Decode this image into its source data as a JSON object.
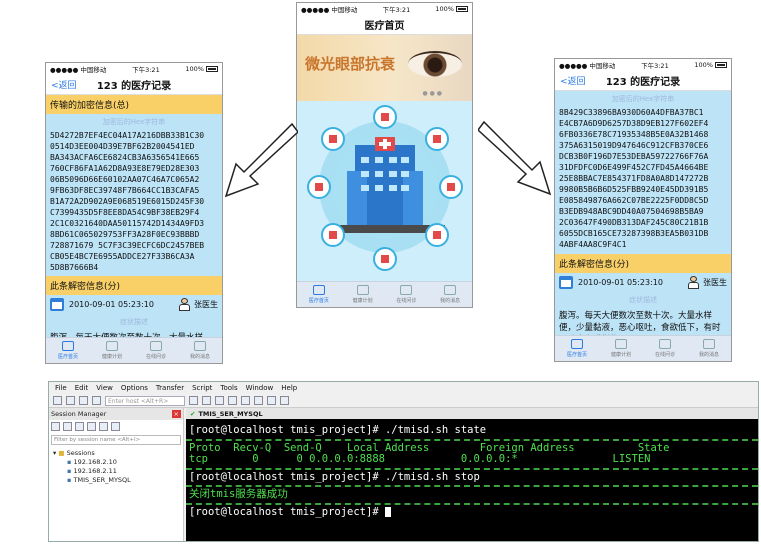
{
  "status_bar": {
    "carrier": "●●●●● 中国移动",
    "time": "下午3:21",
    "battery": "100%"
  },
  "left_phone": {
    "nav": {
      "back": "<返回",
      "title": "123 的医疗记录"
    },
    "enc_header": "传输的加密信息(总)",
    "faint_label": "加密后的Hex字符串",
    "hex_lines": [
      "5D4272B7EF4EC04A17A216DBB33B1C30",
      "0514D3EE004D39E7BF62B2004541ED",
      "BA343ACFA6CE6824CB3A6356541E665",
      "760CF86FA1A62D8A93E8E79ED28E303",
      "06B5096D66E60102AA07C46A7C065A2",
      "9FB63DF8EC39748F7B664CC1B3CAFA5",
      "B1A72A2D902A9E068519E6015D245F30",
      "C7399435D5F8EE8DA54C9BF38EB29F4",
      "2C1C0321640DAA50115742D1434A9FD3",
      "8BD61C065029753FF3A28F0EC93BBBD",
      "728871679 5C7F3C39ECFC6DC2457BEB",
      "CB05E4BC7E6955ADDCE27F33B6CA3A",
      "5D8B7666B4"
    ],
    "dec_header": "此条解密信息(分)",
    "date": "2010-09-01 05:23:10",
    "doctor": "张医生",
    "faint_label2": "症状描述",
    "desc": "腹泻。每天大便数次至数十次。大量水样便，少量黏液，恶心呕吐，食欲低下，有"
  },
  "center_phone": {
    "nav_title": "医疗首页",
    "banner_text": "微光眼部抗衰",
    "tabs": [
      "医疗首页",
      "健康计划",
      "在线问诊",
      "我的消息"
    ]
  },
  "right_phone": {
    "nav": {
      "back": "<返回",
      "title": "123 的医疗记录"
    },
    "faint_label": "加密后的Hex字符串",
    "hex_lines": [
      "8B429C33896BA930D60A4DFBA37BC1",
      "E4CB7A6D9D6257D38D9EB127F602EF4",
      "6FB0336E78C71935348B5E0A32B1468",
      "375A6315019D947646C912CFB370CE6",
      "DCB3B0F196D7E53DEBA59722766F76A",
      "31DFDFC0D6E499F452C7FD45A4664BE",
      "25E8BBAC7E854371FD8A0A8D147272B",
      "9980B5B6B6D525FBB9240E45DD391B5",
      "E085849876A662C07BE2225F0DD8C5D",
      "B3EDB948ABC9DD40A07504698B5BA9",
      "2C03647F490DB313DAF245C80C21B1B",
      "6055DCB165CE73287398B3EA5B031DB",
      "4ABF4AA8C9F4C1"
    ],
    "dec_header": "此条解密信息(分)",
    "date": "2010-09-01 05:23:10",
    "doctor": "张医生",
    "faint_label2": "症状描述",
    "desc": "腹泻。每天大便数次至数十次。大量水样便，少量黏液，恶心呕吐，食欲低下，有时呕吐出咖啡样物"
  },
  "phone_tabs": [
    "医疗首页",
    "健康计划",
    "在线问诊",
    "我的消息"
  ],
  "terminal": {
    "menu": [
      "File",
      "Edit",
      "View",
      "Options",
      "Transfer",
      "Script",
      "Tools",
      "Window",
      "Help"
    ],
    "host_placeholder": "Enter host <Alt+R>",
    "session_title": "Session Manager",
    "filter_placeholder": "Filter by session name <Alt+I>",
    "tree": [
      "Sessions",
      "192.168.2.10",
      "192.168.2.11",
      "TMIS_SER_MYSQL"
    ],
    "tab_label": "TMIS_SER_MYSQL",
    "lines": [
      "[root@localhost tmis_project]# ./tmisd.sh state",
      "Proto  Recv-Q  Send-Q    Local Address        Foreign Address          State",
      "tcp       0      0 0.0.0.0:8888            0.0.0.0:*               LISTEN",
      "[root@localhost tmis_project]# ./tmisd.sh stop",
      "关闭tmis服务器成功",
      "[root@localhost tmis_project]# "
    ]
  }
}
